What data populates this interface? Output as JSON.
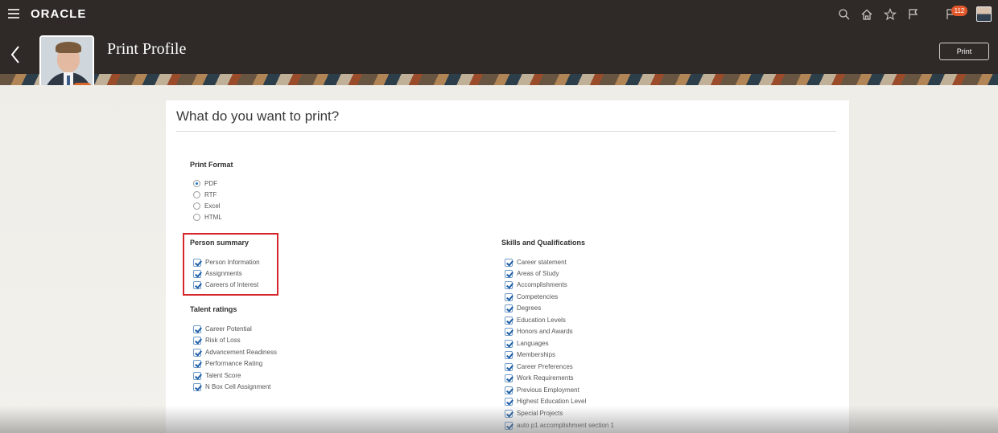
{
  "header": {
    "brand": "ORACLE",
    "notification_count": "112"
  },
  "banner": {
    "title": "Print Profile",
    "print_label": "Print",
    "photo_menu": "···"
  },
  "main": {
    "question": "What do you want to print?",
    "print_format": {
      "heading": "Print Format",
      "options": [
        "PDF",
        "RTF",
        "Excel",
        "HTML"
      ],
      "selected": "PDF"
    },
    "person_summary": {
      "heading": "Person summary",
      "items": [
        "Person Information",
        "Assignments",
        "Careers of Interest"
      ]
    },
    "talent_ratings": {
      "heading": "Talent ratings",
      "items": [
        "Career Potential",
        "Risk of Loss",
        "Advancement Readiness",
        "Performance Rating",
        "Talent Score",
        "N Box Cell Assignment"
      ]
    },
    "skills": {
      "heading": "Skills and Qualifications",
      "items": [
        "Career statement",
        "Areas of Study",
        "Accomplishments",
        "Competencies",
        "Degrees",
        "Education Levels",
        "Honors and Awards",
        "Languages",
        "Memberships",
        "Career Preferences",
        "Work Requirements",
        "Previous Employment",
        "Highest Education Level",
        "Special Projects",
        "auto p1 accomplishment section 1"
      ]
    }
  },
  "colors": {
    "header_bg": "#2f2a27",
    "highlight": "#d7262b",
    "notification": "#e2582a"
  }
}
